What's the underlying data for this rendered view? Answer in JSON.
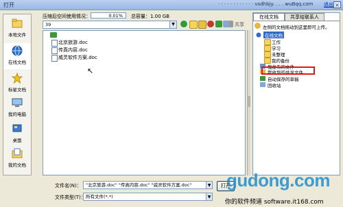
{
  "window": {
    "title": "打开",
    "user": "· · · · · · · · · · · · vsdhbjy. . . . wuBqq.com",
    "logout": "退出",
    "close_glyph": "×"
  },
  "places": [
    {
      "label": "本地文件",
      "icon": "folder-icon"
    },
    {
      "label": "在线文档",
      "icon": "globe-icon"
    },
    {
      "label": "标星文档",
      "icon": "star-icon"
    },
    {
      "label": "我的电脑",
      "icon": "computer-icon"
    },
    {
      "label": "桌面",
      "icon": "desktop-icon"
    },
    {
      "label": "我的文档",
      "icon": "documents-icon"
    }
  ],
  "quota": {
    "label": "压缩后空间使用情况：",
    "used_percent_text": "0.01%",
    "used_fraction": 0.0001,
    "total": "总容量：1.00 GB"
  },
  "path": {
    "value": "39",
    "share_label": "共享"
  },
  "toolbar_icons": [
    "back-icon",
    "up-folder-icon",
    "new-folder-icon",
    "delete-icon",
    "refresh-icon",
    "view-icon",
    "tools-icon"
  ],
  "files": [
    {
      "name": "北京旅游.doc"
    },
    {
      "name": "传真内容.doc"
    },
    {
      "name": "威灵软件方案.doc"
    }
  ],
  "right_panel": {
    "tabs": [
      "在线文档",
      "共享给联系人"
    ],
    "hint": "左侧的文档拖动到这里即可上传。",
    "tree": [
      {
        "label": "在线文档",
        "level": 0,
        "icon": "globe-icon",
        "root": true
      },
      {
        "label": "工作",
        "level": 1,
        "icon": "folder-icon"
      },
      {
        "label": "学习",
        "level": 1,
        "icon": "folder-icon"
      },
      {
        "label": "未整理",
        "level": 1,
        "icon": "folder-icon"
      },
      {
        "label": "我的备份",
        "level": 1,
        "icon": "folder-icon"
      },
      {
        "label": "我发布的文件",
        "level": 0,
        "icon": "publish-icon"
      },
      {
        "label": "我收到的共享文件",
        "level": 0,
        "icon": "shared-icon"
      },
      {
        "label": "自动保存的草稿",
        "level": 0,
        "icon": "draft-icon"
      },
      {
        "label": "回收站",
        "level": 0,
        "icon": "recycle-icon"
      }
    ]
  },
  "bottom": {
    "filename_label": "文件名(N)：",
    "filename_value": "\"北京旅游.doc\" \"传真内容.doc\" \"威灵软件方案.doc\"",
    "filetype_label": "文件类型(T)：",
    "filetype_value": "所有文件(*.*)",
    "open_button": "打开"
  },
  "watermark": {
    "site": "gudong.com",
    "caption": "你的软件频道 software.it168.com"
  },
  "colors": {
    "titlebar": "#9ab7e3",
    "selection": "#316ac5",
    "highlight_border": "#e01818",
    "watermark": "#1e8fd0"
  }
}
